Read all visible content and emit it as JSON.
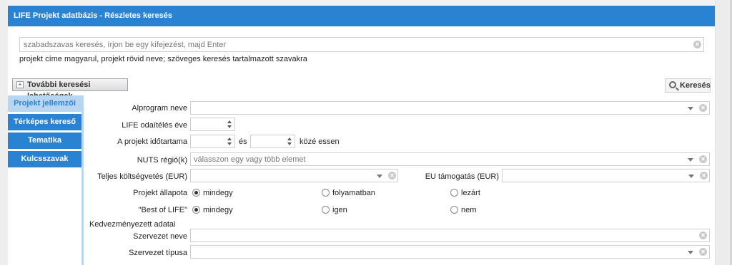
{
  "window": {
    "title": "LIFE Projekt adatbázis - Részletes keresés"
  },
  "search": {
    "placeholder": "szabadszavas keresés, írjon be egy kifejezést, majd Enter",
    "hint": "projekt címe magyarul, projekt rövid neve; szöveges keresés tartalmazott szavakra"
  },
  "toolbar": {
    "more_options_label": "További keresési lehetőségek",
    "search_label": "Keresés"
  },
  "tabs": [
    {
      "label": "Projekt jellemzői",
      "active": true
    },
    {
      "label": "Térképes kereső",
      "active": false
    },
    {
      "label": "Tematika",
      "active": false
    },
    {
      "label": "Kulcsszavak",
      "active": false
    }
  ],
  "form": {
    "subprogram_label": "Alprogram neve",
    "award_year_label": "LIFE odaítélés éve",
    "duration_label": "A projekt időtartama",
    "duration_and": "és",
    "duration_between": "közé essen",
    "nuts_label": "NUTS régió(k)",
    "nuts_placeholder": "válasszon egy vagy több elemet",
    "total_budget_label": "Teljes költségvetés (EUR)",
    "eu_support_label": "EU támogatás (EUR)",
    "status_label": "Projekt állapota",
    "status_options": [
      "mindegy",
      "folyamatban",
      "lezárt"
    ],
    "status_selected": "mindegy",
    "best_label": "\"Best of LIFE\"",
    "best_options": [
      "mindegy",
      "igen",
      "nem"
    ],
    "best_selected": "mindegy",
    "beneficiary_heading": "Kedvezményezett adatai",
    "org_name_label": "Szervezet neve",
    "org_type_label": "Szervezet típusa"
  },
  "colors": {
    "accent": "#2a83d2",
    "active_tab_bg": "#b8d6ef"
  }
}
